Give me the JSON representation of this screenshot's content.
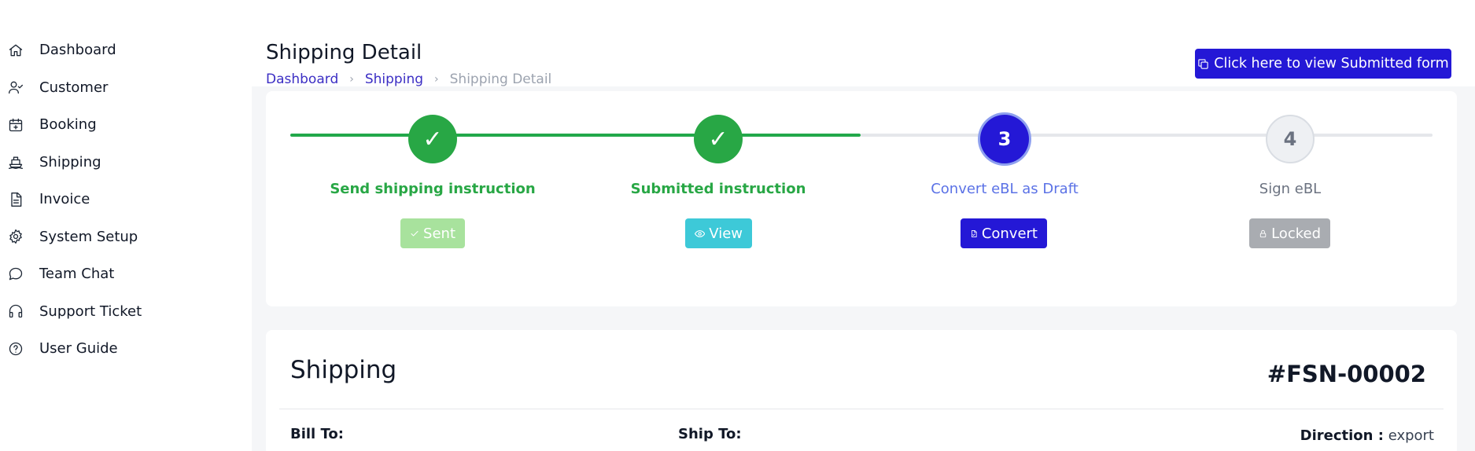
{
  "sidebar": {
    "items": [
      {
        "label": "Dashboard",
        "icon": "home-icon"
      },
      {
        "label": "Customer",
        "icon": "user-check-icon"
      },
      {
        "label": "Booking",
        "icon": "calendar-plus-icon"
      },
      {
        "label": "Shipping",
        "icon": "ship-icon"
      },
      {
        "label": "Invoice",
        "icon": "file-text-icon"
      },
      {
        "label": "System Setup",
        "icon": "gear-icon"
      },
      {
        "label": "Team Chat",
        "icon": "chat-icon"
      },
      {
        "label": "Support Ticket",
        "icon": "headphones-icon"
      },
      {
        "label": "User Guide",
        "icon": "help-circle-icon"
      }
    ]
  },
  "header": {
    "title": "Shipping Detail",
    "breadcrumb": [
      "Dashboard",
      "Shipping",
      "Shipping Detail"
    ],
    "action_button": "Click here to view Submitted form"
  },
  "stepper": {
    "steps": [
      {
        "marker": "✓",
        "label": "Send shipping instruction",
        "button": "Sent",
        "status": "done"
      },
      {
        "marker": "✓",
        "label": "Submitted instruction",
        "button": "View",
        "status": "done"
      },
      {
        "marker": "3",
        "label": "Convert eBL as Draft",
        "button": "Convert",
        "status": "active"
      },
      {
        "marker": "4",
        "label": "Sign eBL",
        "button": "Locked",
        "status": "pending"
      }
    ]
  },
  "shipping": {
    "title": "Shipping",
    "number": "#FSN-00002",
    "bill_to_label": "Bill To:",
    "ship_to_label": "Ship To:",
    "direction_label": "Direction :",
    "direction_value": "export"
  },
  "colors": {
    "primary": "#2418d6",
    "success": "#28a745",
    "info": "#3dc9d8",
    "muted": "#a9acb1"
  }
}
